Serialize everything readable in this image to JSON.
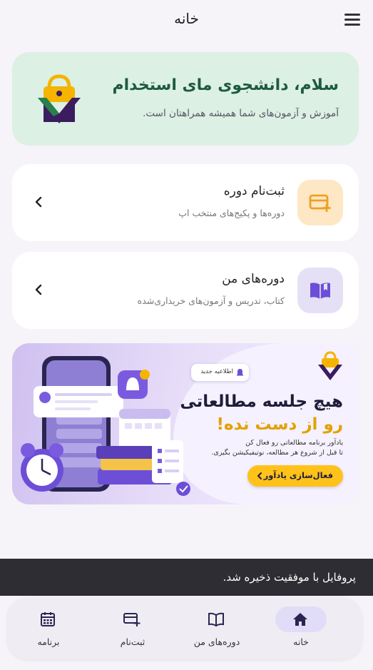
{
  "header": {
    "title": "خانه"
  },
  "welcome": {
    "heading": "سلام، دانشجوی مای استخدام",
    "subtitle": "آموزش و آزمون‌های شما همیشه همراهتان است."
  },
  "cards": [
    {
      "title": "ثبت‌نام دوره",
      "subtitle": "دوره‌ها و پکیج‌های منتخب اپ",
      "icon": "card-add-icon",
      "color": "#fde7c4"
    },
    {
      "title": "دوره‌های من",
      "subtitle": "کتاب، تدریس و آزمون‌های خریداری‌شده",
      "icon": "open-book-icon",
      "color": "#e6e0f7"
    }
  ],
  "banner": {
    "badge": "اطلاعیه جدید",
    "title_line1": "هیچ جلسه مطالعاتی",
    "title_line2": "رو از دست نده!",
    "desc_line1": "یادآور برنامه مطالعاتی رو فعال کن",
    "desc_line2": "تا قبل از شروع هر مطالعه، نوتیفیکیشن بگیری.",
    "cta": "فعال‌سازی یادآور"
  },
  "toast": {
    "message": "پروفایل با موفقیت ذخیره شد."
  },
  "nav": [
    {
      "label": "خانه",
      "icon": "home-icon",
      "active": true
    },
    {
      "label": "دوره‌های من",
      "icon": "open-book-icon",
      "active": false
    },
    {
      "label": "ثبت‌نام",
      "icon": "card-add-icon",
      "active": false
    },
    {
      "label": "برنامه",
      "icon": "calendar-icon",
      "active": false
    }
  ]
}
